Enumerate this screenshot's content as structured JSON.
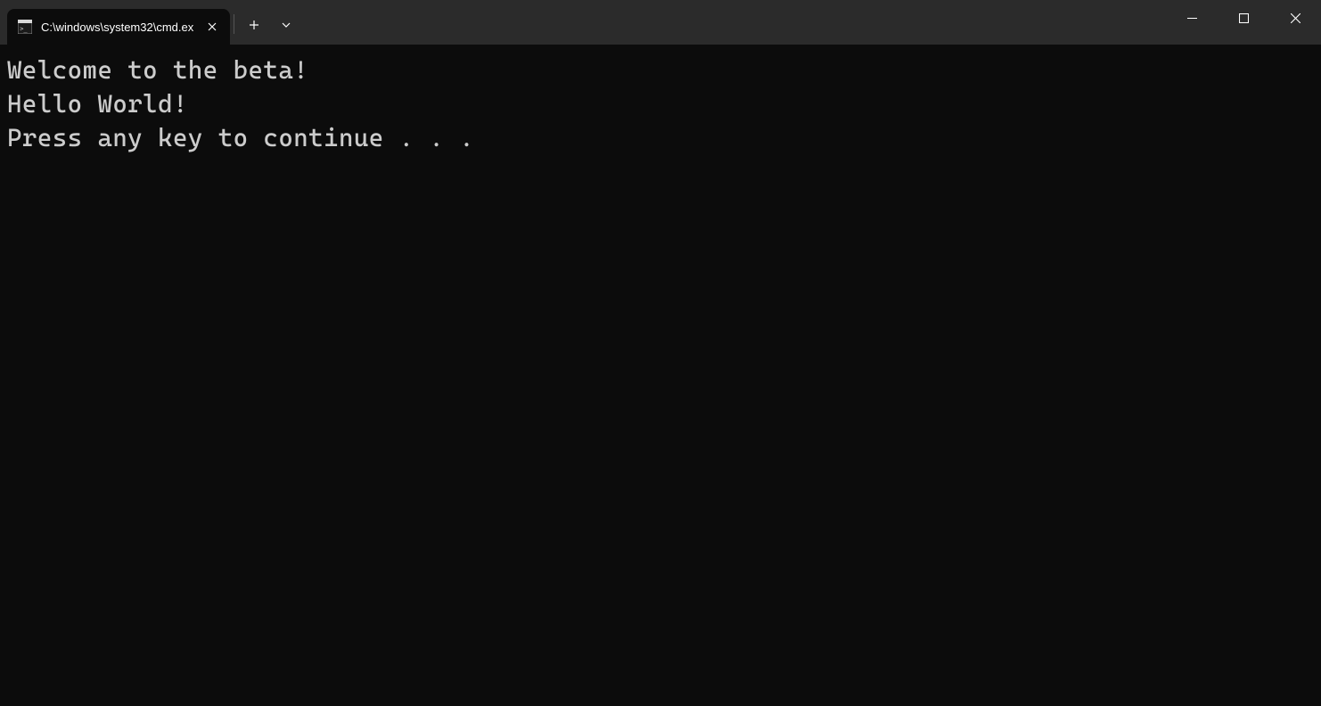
{
  "tab": {
    "title": "C:\\windows\\system32\\cmd.ex"
  },
  "terminal": {
    "lines": [
      "Welcome to the beta!",
      "Hello World!",
      "Press any key to continue . . ."
    ]
  }
}
